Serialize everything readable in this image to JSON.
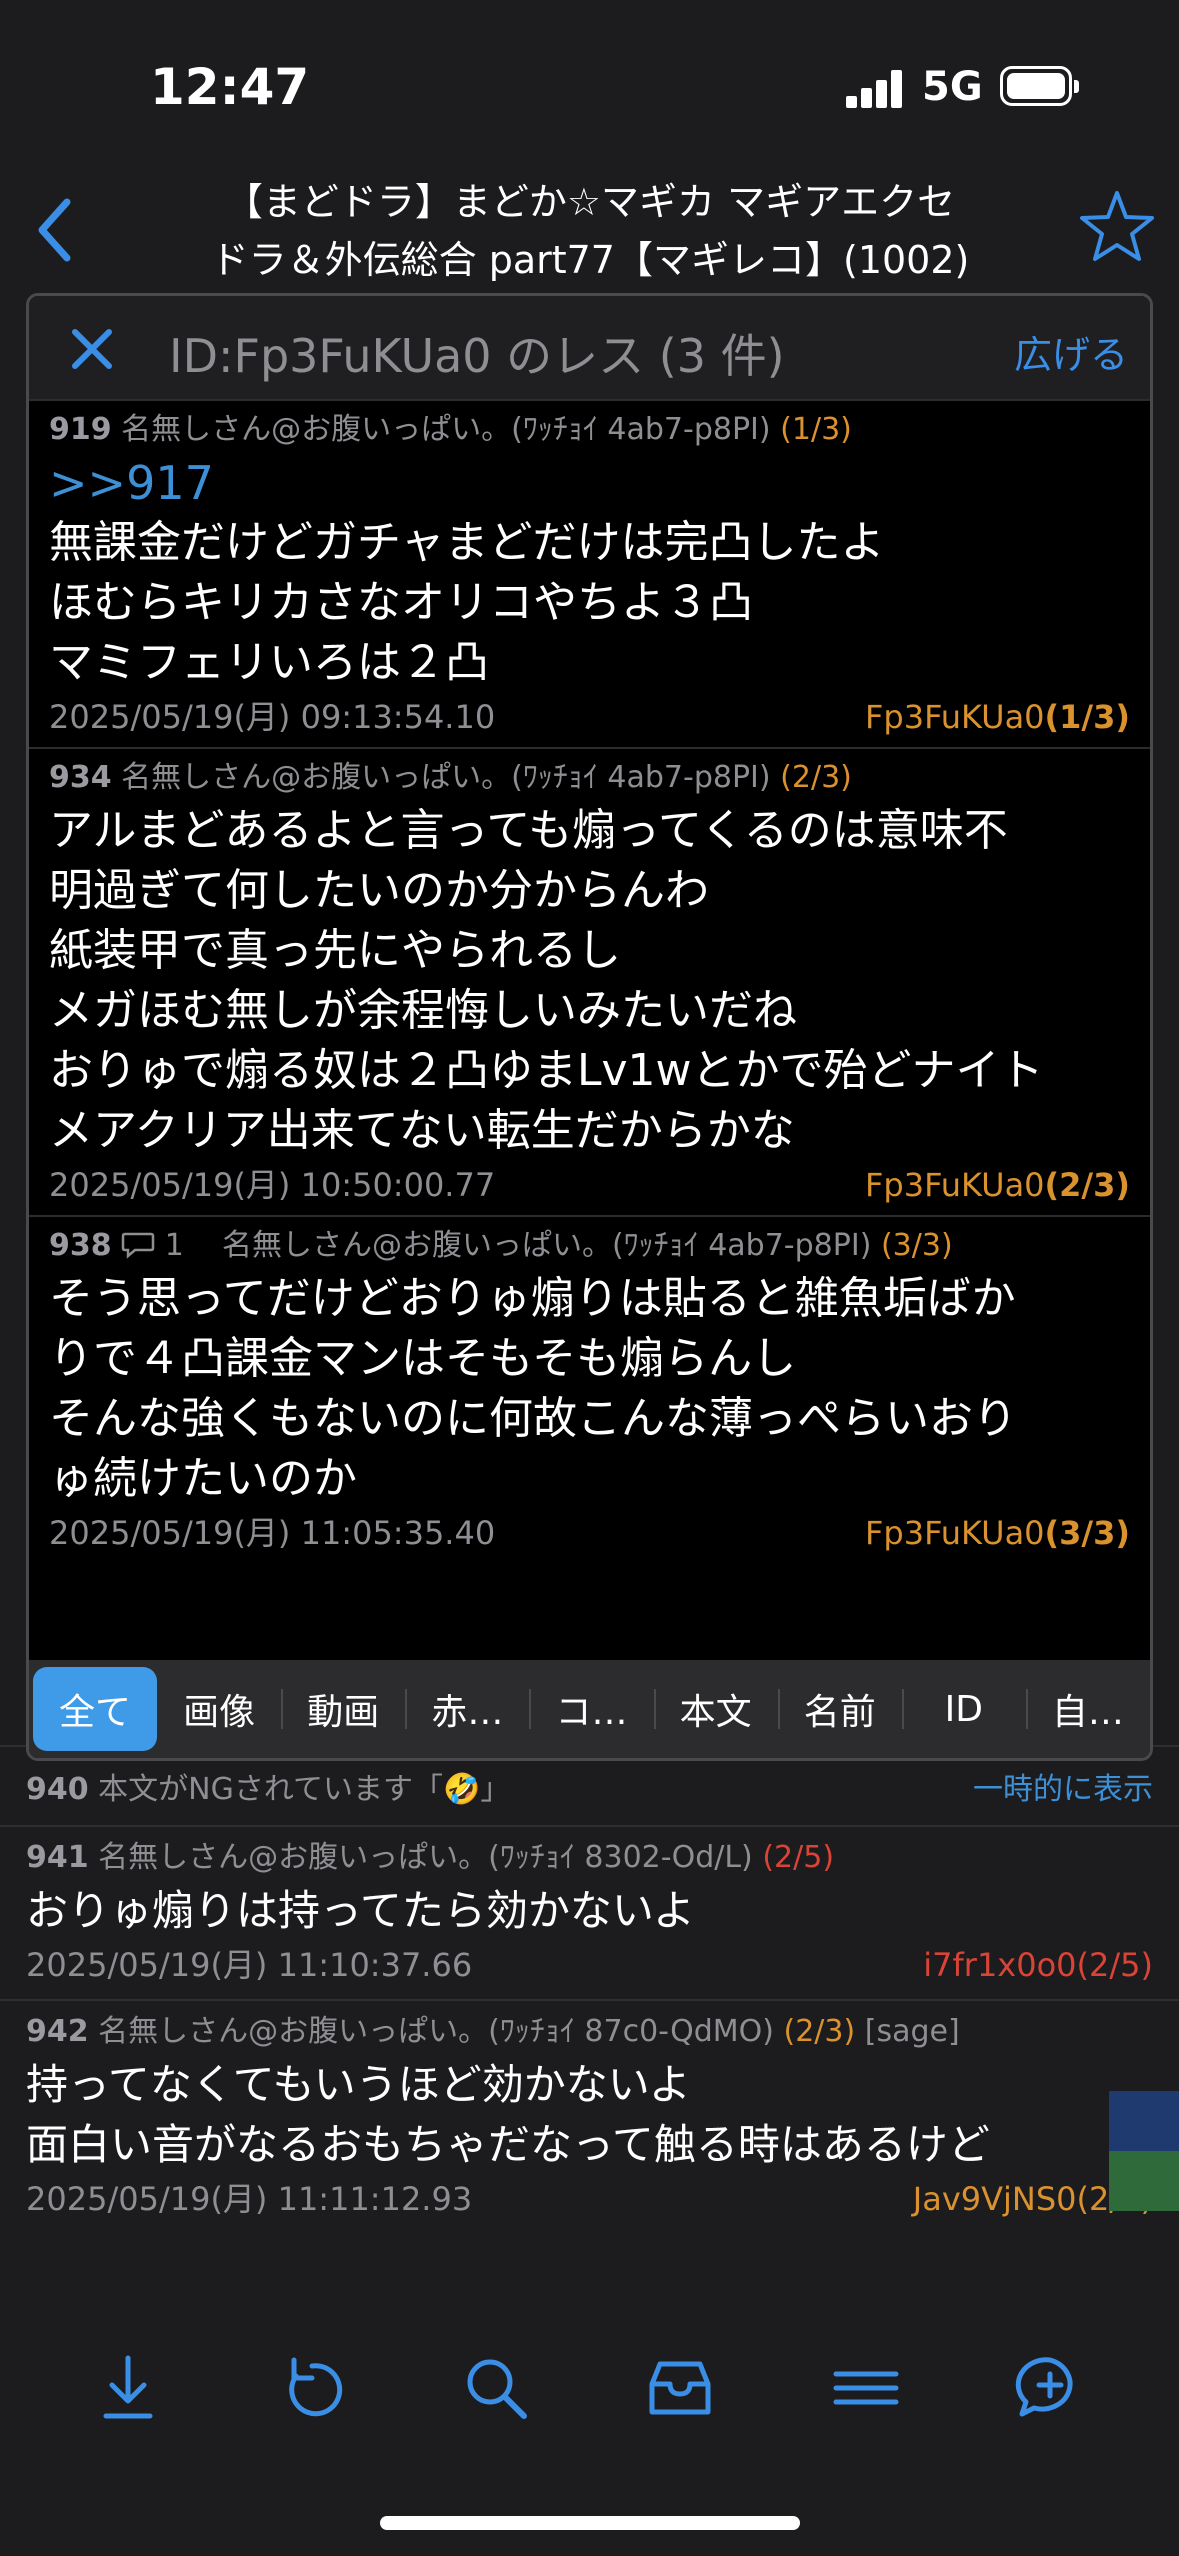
{
  "status_bar": {
    "time": "12:47",
    "network": "5G"
  },
  "nav": {
    "title_line1": "【まどドラ】まどか☆マギカ マギアエクセ",
    "title_line2": "ドラ＆外伝総合 part77【マギレコ】(1002)"
  },
  "popup": {
    "title": "ID:Fp3FuKUa0 のレス (3 件)",
    "expand_label": "広げる",
    "posts": [
      {
        "num": "919",
        "name": "名無しさん@お腹いっぱい。(ﾜｯﾁｮｲ 4ab7-p8PI)",
        "count": "(1/3)",
        "anchor": ">>917",
        "lines": [
          "無課金だけどガチャまどだけは完凸したよ",
          "ほむらキリカさなオリコやちよ３凸",
          "マミフェリいろは２凸"
        ],
        "date": "2025/05/19(月) 09:13:54.10",
        "id": "Fp3FuKUa0",
        "id_count": "(1/3)"
      },
      {
        "num": "934",
        "name": "名無しさん@お腹いっぱい。(ﾜｯﾁｮｲ 4ab7-p8PI)",
        "count": "(2/3)",
        "lines": [
          "アルまどあるよと言っても煽ってくるのは意味不",
          "明過ぎて何したいのか分からんわ",
          "紙装甲で真っ先にやられるし",
          "メガほむ無しが余程悔しいみたいだね",
          "おりゅで煽る奴は２凸ゆまLv1wとかで殆どナイト",
          "メアクリア出来てない転生だからかな"
        ],
        "date": "2025/05/19(月) 10:50:00.77",
        "id": "Fp3FuKUa0",
        "id_count": "(2/3)"
      },
      {
        "num": "938",
        "replies": "1",
        "name": "名無しさん@お腹いっぱい。(ﾜｯﾁｮｲ 4ab7-p8PI)",
        "count": "(3/3)",
        "lines": [
          "そう思ってだけどおりゅ煽りは貼ると雑魚垢ばか",
          "りで４凸課金マンはそもそも煽らんし",
          "そんな強くもないのに何故こんな薄っぺらいおり",
          "ゅ続けたいのか"
        ],
        "date": "2025/05/19(月) 11:05:35.40",
        "id": "Fp3FuKUa0",
        "id_count": "(3/3)"
      }
    ],
    "filters": [
      "全て",
      "画像",
      "動画",
      "赤…",
      "コ…",
      "本文",
      "名前",
      "ID",
      "自…"
    ]
  },
  "thread": {
    "post940": {
      "num": "940",
      "text": "本文がNGされています「🤣」",
      "show_label": "一時的に表示"
    },
    "post941": {
      "num": "941",
      "name": "名無しさん@お腹いっぱい。(ﾜｯﾁｮｲ 8302-Od/L)",
      "count": "(2/5)",
      "line": "おりゅ煽りは持ってたら効かないよ",
      "date": "2025/05/19(月) 11:10:37.66",
      "id": "i7fr1x0o0",
      "id_count": "(2/5)"
    },
    "post942": {
      "num": "942",
      "name": "名無しさん@お腹いっぱい。(ﾜｯﾁｮｲ 87c0-QdMO)",
      "count": "(2/3)",
      "sage": "[sage]",
      "line1": "持ってなくてもいうほど効かないよ",
      "line2": "面白い音がなるおもちゃだなって触る時はあるけど",
      "date": "2025/05/19(月) 11:11:12.93",
      "id": "Jav9VjNS0",
      "id_count": "(2/3)"
    }
  },
  "tabbar_icons": [
    "download-icon",
    "refresh-icon",
    "search-icon",
    "inbox-icon",
    "menu-icon",
    "compose-icon"
  ],
  "colors": {
    "accent": "#3a8ee6",
    "orange": "#d9922e",
    "red": "#d94437"
  }
}
